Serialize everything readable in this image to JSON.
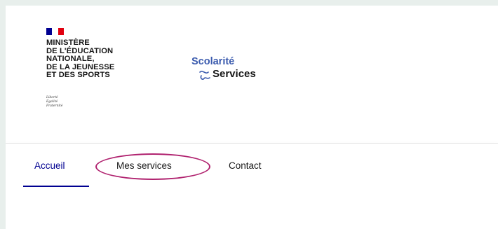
{
  "header": {
    "ministry_lines": [
      "MINISTÈRE",
      "DE L'ÉDUCATION",
      "NATIONALE,",
      "DE LA JEUNESSE",
      "ET DES SPORTS"
    ],
    "motto_lines": [
      "Liberté",
      "Égalité",
      "Fraternité"
    ],
    "brand_top": "Scolarité",
    "brand_bottom": "Services"
  },
  "colors": {
    "flag_blue": "#000091",
    "flag_red": "#e1000f",
    "brand_blue": "#3b5bae",
    "active_nav": "#000091",
    "highlight_circle": "#b0226f"
  },
  "nav": {
    "items": [
      {
        "label": "Accueil",
        "active": true
      },
      {
        "label": "Mes services",
        "active": false
      },
      {
        "label": "Contact",
        "active": false
      }
    ]
  }
}
